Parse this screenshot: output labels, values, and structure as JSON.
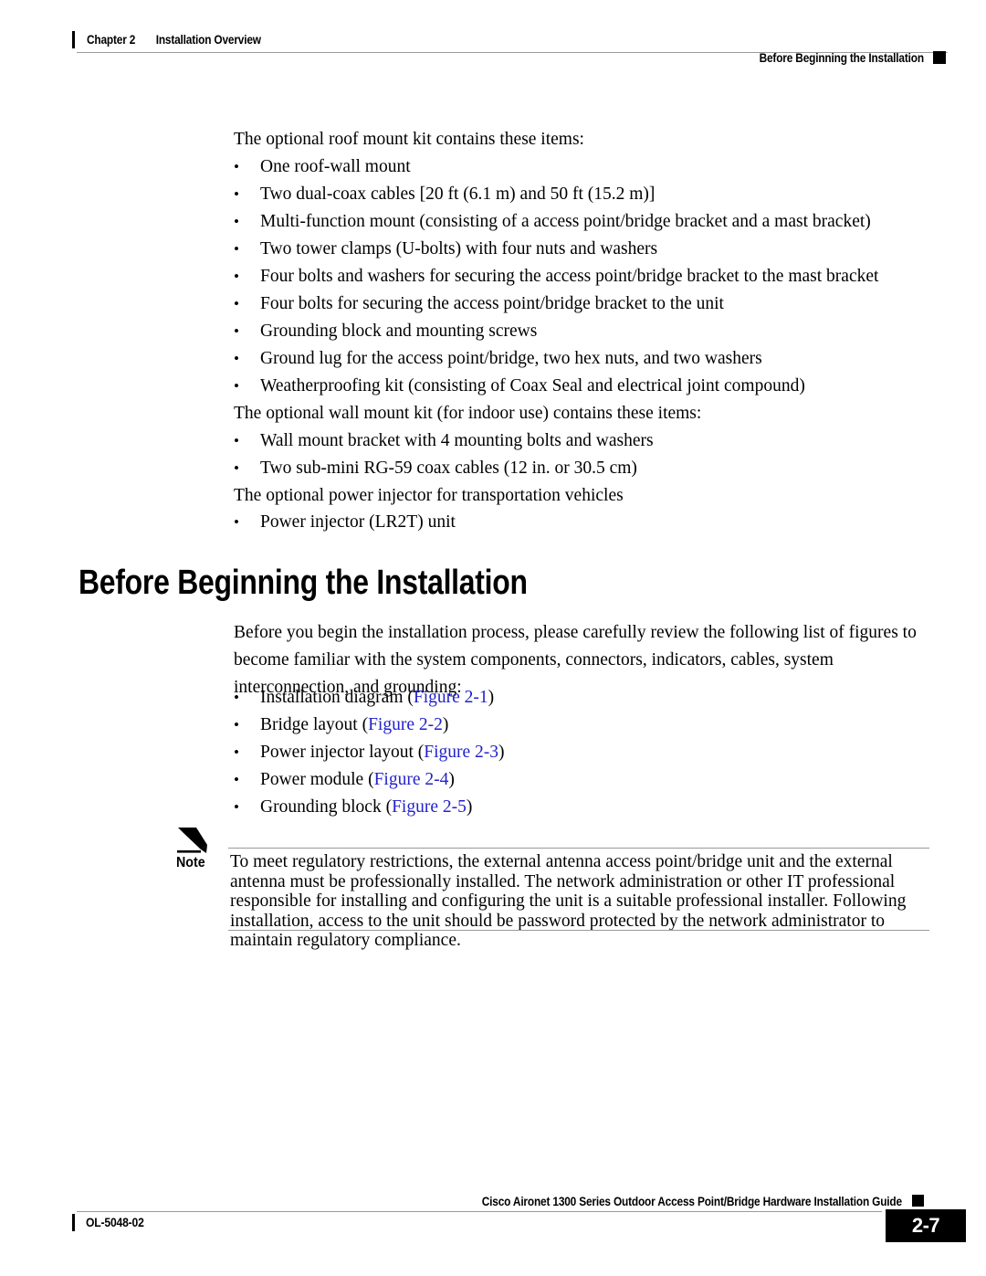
{
  "header": {
    "chapter": "Chapter 2",
    "chapter_title": "Installation Overview",
    "section_right": "Before Beginning the Installation"
  },
  "body": {
    "intro_roof": "The optional roof mount kit contains these items:",
    "roof_items": [
      "One roof-wall mount",
      "Two dual-coax cables [20 ft (6.1 m) and 50 ft (15.2 m)]",
      "Multi-function mount (consisting of a access point/bridge bracket and a mast bracket)",
      "Two tower clamps (U-bolts) with four nuts and washers",
      "Four bolts and washers for securing the access point/bridge bracket to the mast bracket",
      "Four bolts for securing the access point/bridge bracket to the unit",
      "Grounding block and mounting screws",
      "Ground lug for the access point/bridge, two hex nuts, and two washers",
      "Weatherproofing kit (consisting of Coax Seal and electrical joint compound)"
    ],
    "intro_wall": "The optional wall mount kit (for indoor use) contains these items:",
    "wall_items": [
      "Wall mount bracket with 4 mounting bolts and washers",
      "Two sub-mini RG-59 coax cables (12 in. or 30.5 cm)"
    ],
    "intro_power": "The optional power injector for transportation vehicles",
    "power_items": [
      "Power injector (LR2T) unit"
    ]
  },
  "section": {
    "heading": "Before Beginning the Installation",
    "paragraph": "Before you begin the installation process, please carefully review the following list of figures to become familiar with the system components, connectors, indicators, cables, system interconnection, and grounding:",
    "figure_items": [
      {
        "label": "Installation diagram",
        "open": " (",
        "link": "Figure 2-1",
        "close": ")"
      },
      {
        "label": "Bridge layout",
        "open": " (",
        "link": "Figure 2-2",
        "close": ")"
      },
      {
        "label": "Power injector layout",
        "open": " (",
        "link": "Figure 2-3",
        "close": ")"
      },
      {
        "label": "Power module",
        "open": " (",
        "link": "Figure 2-4",
        "close": ")"
      },
      {
        "label": "Grounding block",
        "open": " (",
        "link": "Figure 2-5",
        "close": ")"
      }
    ],
    "link_color": "#2222cc"
  },
  "note": {
    "label": "Note",
    "icon": "pencil-icon",
    "text": "To meet regulatory restrictions, the external antenna access point/bridge unit and the external antenna must be professionally installed. The network administration or other IT professional responsible for installing and configuring the unit is a suitable professional installer. Following installation, access to the unit should be password protected by the network administrator to maintain regulatory compliance."
  },
  "footer": {
    "guide_title": "Cisco Aironet 1300 Series Outdoor Access Point/Bridge Hardware Installation Guide",
    "doc_number": "OL-5048-02",
    "page_number": "2-7"
  }
}
